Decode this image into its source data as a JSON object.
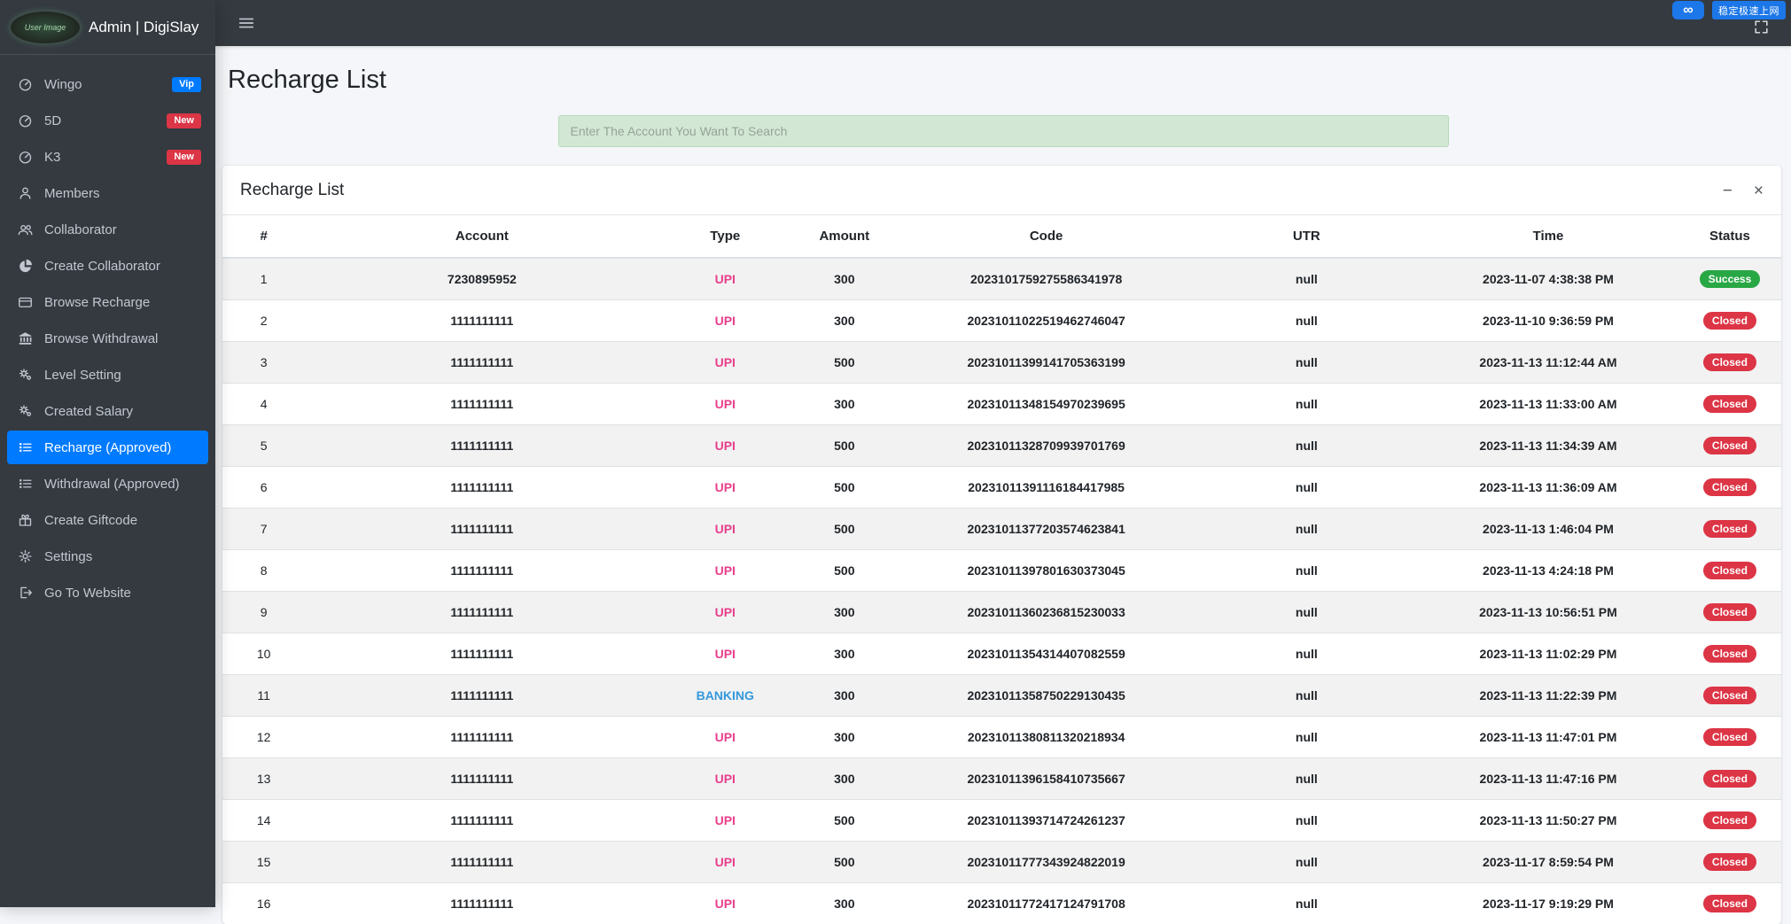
{
  "brand": {
    "title": "Admin | DigiSlay",
    "avatar_text": "User Image"
  },
  "topbar": {
    "overlay_logo_glyph": "∞",
    "overlay_badge_text": "稳定极速上网"
  },
  "page": {
    "title": "Recharge List"
  },
  "search": {
    "placeholder": "Enter The Account You Want To Search"
  },
  "card": {
    "title": "Recharge List",
    "minimize_label": "−",
    "close_label": "×"
  },
  "sidebar": {
    "items": [
      {
        "label": "Wingo",
        "icon": "gauge-icon",
        "badge": "Vip",
        "badge_color": "#007bff"
      },
      {
        "label": "5D",
        "icon": "gauge-icon",
        "badge": "New",
        "badge_color": "#dc3545"
      },
      {
        "label": "K3",
        "icon": "gauge-icon",
        "badge": "New",
        "badge_color": "#dc3545"
      },
      {
        "label": "Members",
        "icon": "user-icon"
      },
      {
        "label": "Collaborator",
        "icon": "users-icon"
      },
      {
        "label": "Create Collaborator",
        "icon": "pie-chart-icon"
      },
      {
        "label": "Browse Recharge",
        "icon": "credit-card-icon"
      },
      {
        "label": "Browse Withdrawal",
        "icon": "bank-icon"
      },
      {
        "label": "Level Setting",
        "icon": "cogs-icon"
      },
      {
        "label": "Created Salary",
        "icon": "cogs-icon"
      },
      {
        "label": "Recharge (Approved)",
        "icon": "list-icon",
        "active": true
      },
      {
        "label": "Withdrawal (Approved)",
        "icon": "list-icon"
      },
      {
        "label": "Create Giftcode",
        "icon": "gift-icon"
      },
      {
        "label": "Settings",
        "icon": "gear-icon"
      },
      {
        "label": "Go To Website",
        "icon": "sign-out-icon"
      }
    ]
  },
  "table": {
    "columns": [
      "#",
      "Account",
      "Type",
      "Amount",
      "Code",
      "UTR",
      "Time",
      "Status"
    ],
    "type_colors": {
      "UPI": "#e83e8c",
      "BANKING": "#3498db"
    },
    "status_colors": {
      "Success": "#28a745",
      "Closed": "#dc3545"
    },
    "rows": [
      [
        "1",
        "7230895952",
        "UPI",
        "300",
        "2023101759275586341978",
        "null",
        "2023-11-07 4:38:38 PM",
        "Success"
      ],
      [
        "2",
        "1111111111",
        "UPI",
        "300",
        "20231011022519462746047",
        "null",
        "2023-11-10 9:36:59 PM",
        "Closed"
      ],
      [
        "3",
        "1111111111",
        "UPI",
        "500",
        "20231011399141705363199",
        "null",
        "2023-11-13 11:12:44 AM",
        "Closed"
      ],
      [
        "4",
        "1111111111",
        "UPI",
        "300",
        "20231011348154970239695",
        "null",
        "2023-11-13 11:33:00 AM",
        "Closed"
      ],
      [
        "5",
        "1111111111",
        "UPI",
        "500",
        "20231011328709939701769",
        "null",
        "2023-11-13 11:34:39 AM",
        "Closed"
      ],
      [
        "6",
        "1111111111",
        "UPI",
        "500",
        "20231011391116184417985",
        "null",
        "2023-11-13 11:36:09 AM",
        "Closed"
      ],
      [
        "7",
        "1111111111",
        "UPI",
        "500",
        "20231011377203574623841",
        "null",
        "2023-11-13 1:46:04 PM",
        "Closed"
      ],
      [
        "8",
        "1111111111",
        "UPI",
        "500",
        "20231011397801630373045",
        "null",
        "2023-11-13 4:24:18 PM",
        "Closed"
      ],
      [
        "9",
        "1111111111",
        "UPI",
        "300",
        "20231011360236815230033",
        "null",
        "2023-11-13 10:56:51 PM",
        "Closed"
      ],
      [
        "10",
        "1111111111",
        "UPI",
        "300",
        "20231011354314407082559",
        "null",
        "2023-11-13 11:02:29 PM",
        "Closed"
      ],
      [
        "11",
        "1111111111",
        "BANKING",
        "300",
        "20231011358750229130435",
        "null",
        "2023-11-13 11:22:39 PM",
        "Closed"
      ],
      [
        "12",
        "1111111111",
        "UPI",
        "300",
        "20231011380811320218934",
        "null",
        "2023-11-13 11:47:01 PM",
        "Closed"
      ],
      [
        "13",
        "1111111111",
        "UPI",
        "300",
        "20231011396158410735667",
        "null",
        "2023-11-13 11:47:16 PM",
        "Closed"
      ],
      [
        "14",
        "1111111111",
        "UPI",
        "500",
        "20231011393714724261237",
        "null",
        "2023-11-13 11:50:27 PM",
        "Closed"
      ],
      [
        "15",
        "1111111111",
        "UPI",
        "500",
        "20231011777343924822019",
        "null",
        "2023-11-17 8:59:54 PM",
        "Closed"
      ],
      [
        "16",
        "1111111111",
        "UPI",
        "300",
        "20231011772417124791708",
        "null",
        "2023-11-17 9:19:29 PM",
        "Closed"
      ]
    ]
  },
  "colors": {
    "accent": "#007bff",
    "sidebar_bg": "#343a40",
    "success": "#28a745",
    "danger": "#dc3545",
    "search_bg": "#d3e8d4"
  }
}
